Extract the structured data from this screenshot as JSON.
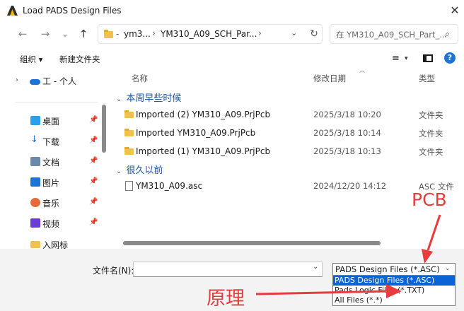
{
  "window": {
    "title": "Load PADS Design Files",
    "close_glyph": "✕"
  },
  "nav": {
    "back": "←",
    "forward": "→",
    "recent": "⌄",
    "up": "↑",
    "breadcrumbs": [
      "ym3...",
      "YM310_A09_SCH_Par..."
    ],
    "sep": "›",
    "lead": "-",
    "addr_dropdown": "⌄",
    "refresh": "↻",
    "search_placeholder": "在 YM310_A09_SCH_Part_...",
    "search_icon": "⌕"
  },
  "toolbar": {
    "organize": "组织 ▾",
    "new_folder": "新建文件夹",
    "view_icon": "≡",
    "view_dd": "▾",
    "help": "?"
  },
  "sidebar": {
    "top_item": {
      "chevron": "›",
      "label": "工 - 个人"
    },
    "items": [
      {
        "label": "桌面",
        "icon": "desktop-icon",
        "color": "#2aa0e8",
        "pinned": true
      },
      {
        "label": "下载",
        "icon": "download-icon",
        "color": "#1e74d6",
        "pinned": true
      },
      {
        "label": "文档",
        "icon": "document-icon",
        "color": "#6b89a8",
        "pinned": true
      },
      {
        "label": "图片",
        "icon": "pictures-icon",
        "color": "#1e74d6",
        "pinned": true
      },
      {
        "label": "音乐",
        "icon": "music-icon",
        "color": "#e56b3a",
        "pinned": true
      },
      {
        "label": "视频",
        "icon": "video-icon",
        "color": "#6b3bd6",
        "pinned": true
      },
      {
        "label": "入网标",
        "icon": "folder-icon",
        "color": "#f0c24d",
        "pinned": false
      }
    ],
    "pin_glyph": "📌"
  },
  "filelist": {
    "columns": {
      "name": "名称",
      "date": "修改日期",
      "type": "类型"
    },
    "groups": [
      {
        "label": "本周早些时候",
        "rows": [
          {
            "name": "Imported (2) YM310_A09.PrjPcb",
            "date": "2025/3/18 10:20",
            "type": "文件夹",
            "kind": "folder"
          },
          {
            "name": "Imported YM310_A09.PrjPcb",
            "date": "2025/3/18 10:14",
            "type": "文件夹",
            "kind": "folder"
          },
          {
            "name": "Imported (1) YM310_A09.PrjPcb",
            "date": "2025/3/18 10:13",
            "type": "文件夹",
            "kind": "folder"
          }
        ]
      },
      {
        "label": "很久以前",
        "rows": [
          {
            "name": "YM310_A09.asc",
            "date": "2024/12/20 14:12",
            "type": "ASC 文件",
            "kind": "file"
          }
        ]
      }
    ],
    "group_chevron": "⌄"
  },
  "bottom": {
    "filename_label": "文件名(N):",
    "filename_value": "",
    "filename_dd": "⌄",
    "filter_selected": "PADS Design Files (*.ASC)",
    "filter_dd": "⌄",
    "filter_options": [
      {
        "label": "PADS Design Files (*.ASC)",
        "selected": true
      },
      {
        "label": "Pads Logic Files (*.TXT)",
        "selected": false
      },
      {
        "label": "All Files (*.*)",
        "selected": false
      }
    ]
  },
  "annotations": {
    "pcb_label": "PCB",
    "logic_label": "原理",
    "color": "#e83c3c"
  }
}
